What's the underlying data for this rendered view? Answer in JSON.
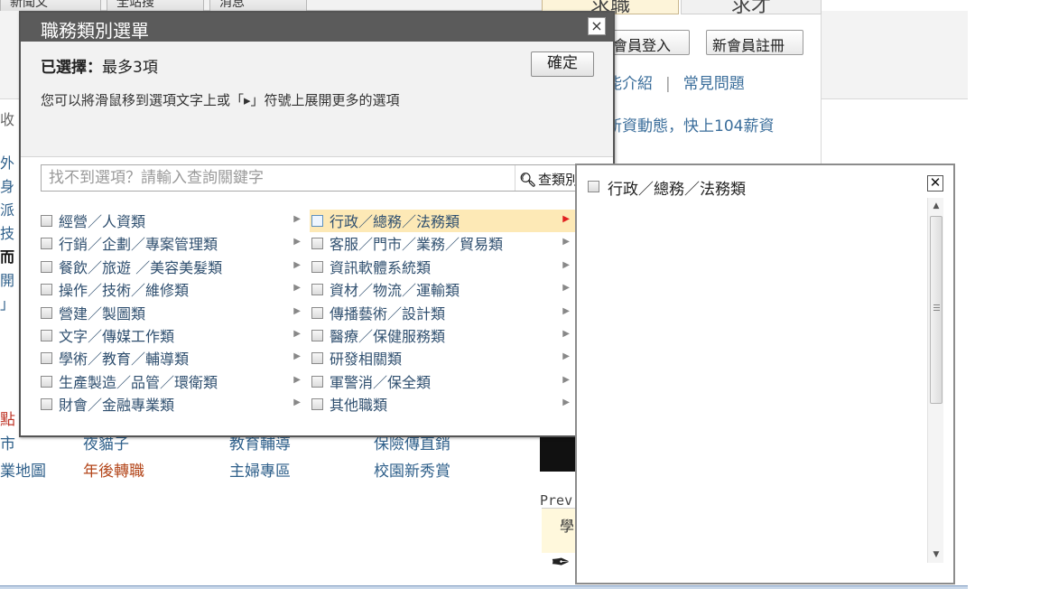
{
  "background": {
    "top_tabs": [
      "新聞文",
      "全站搜",
      "消息"
    ],
    "job_tab": "求職",
    "study_tab": "求才",
    "login_button": "會員登入",
    "register_button": "新會員註冊",
    "links": [
      "能介紹",
      "常見問題"
    ],
    "promo": "新資動態，快上104薪資",
    "left_fragments": [
      "收",
      "外",
      "身",
      "派",
      "技",
      "而",
      "開",
      "」"
    ],
    "bottom_links": [
      {
        "text": "點",
        "color": "#c0392b"
      },
      {
        "text": "市",
        "color": "#2e5f8a"
      },
      {
        "text": "夜貓子",
        "color": "#2e5f8a"
      },
      {
        "text": "教育輔導",
        "color": "#2e5f8a"
      },
      {
        "text": "保險傳直銷",
        "color": "#2e5f8a"
      },
      {
        "text": "業地圖",
        "color": "#2e5f8a"
      },
      {
        "text": "年後轉職",
        "color": "#b3461a"
      },
      {
        "text": "主婦專區",
        "color": "#2e5f8a"
      },
      {
        "text": "校園新秀賞",
        "color": "#2e5f8a"
      }
    ],
    "prev_text": "Prev",
    "yellow_text": "學"
  },
  "dialog": {
    "title": "職務類別選單",
    "close_icon": "×",
    "selected_label": "已選擇：",
    "selected_value": "最多3項",
    "confirm_button": "確定",
    "hint": "您可以將滑鼠移到選項文字上或「▸」符號上展開更多的選項",
    "search": {
      "placeholder": "找不到選項？請輸入查詢關鍵字",
      "button": "查類別"
    },
    "left_categories": [
      "經營／人資類",
      "行銷／企劃／專案管理類",
      "餐飲／旅遊 ／美容美髮類",
      "操作／技術／維修類",
      "營建／製圖類",
      "文字／傳媒工作類",
      "學術／教育／輔導類",
      "生產製造／品管／環衛類",
      "財會／金融專業類"
    ],
    "right_categories": [
      "行政／總務／法務類",
      "客服／門市／業務／貿易類",
      "資訊軟體系統類",
      "資材／物流／運輸類",
      "傳播藝術／設計類",
      "醫療／保健服務類",
      "研發相關類",
      "軍警消／保全類",
      "其他職類"
    ],
    "active_index": 0
  },
  "subpanel": {
    "title": "行政／總務／法務類",
    "close_icon": "✕"
  }
}
